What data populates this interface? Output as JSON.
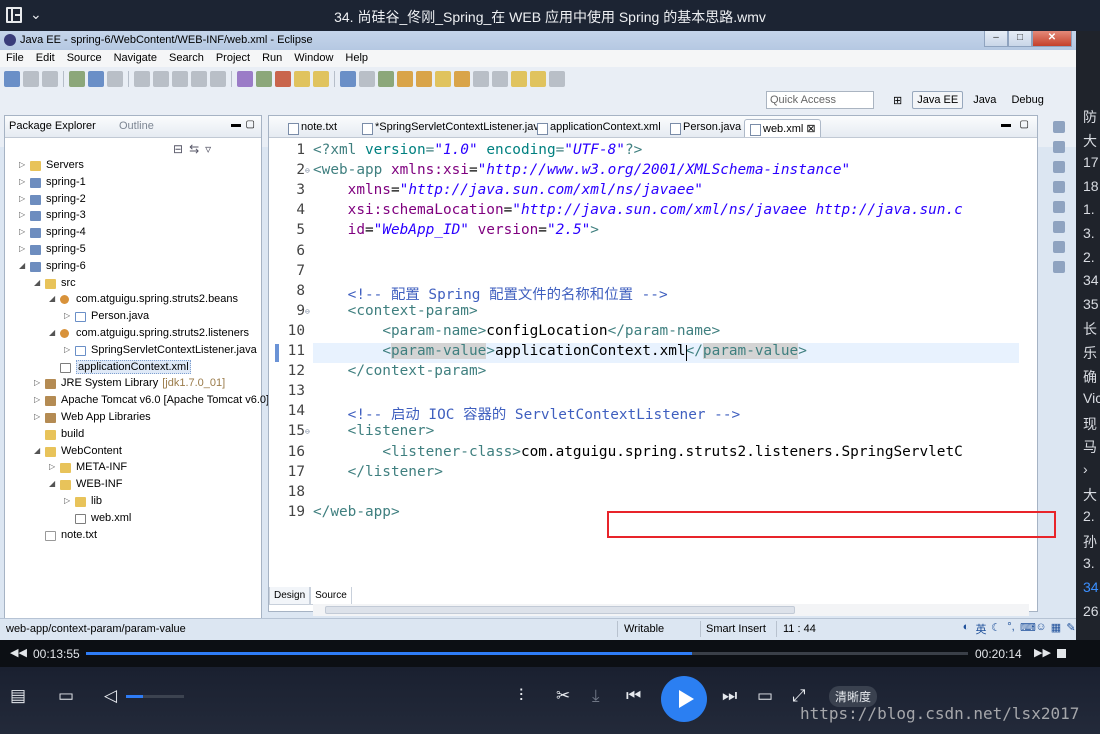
{
  "player": {
    "title": "34. 尚硅谷_佟刚_Spring_在 WEB 应用中使用 Spring 的基本思路.wmv",
    "time_current": "00:13:55",
    "time_total": "00:20:14",
    "progress_fraction": 0.687,
    "volume_fraction": 0.3,
    "quality_label": "清晰度",
    "watermark": "https://blog.csdn.net/lsx2017"
  },
  "eclipse": {
    "window_title": "Java EE - spring-6/WebContent/WEB-INF/web.xml - Eclipse",
    "menu": [
      "File",
      "Edit",
      "Source",
      "Navigate",
      "Search",
      "Project",
      "Run",
      "Window",
      "Help"
    ],
    "quick_access_placeholder": "Quick Access",
    "perspectives": [
      "Java EE",
      "Java",
      "Debug"
    ],
    "active_perspective": "Java EE"
  },
  "package_explorer": {
    "tab_label": "Package Explorer",
    "outline_label": "Outline",
    "tree": [
      {
        "depth": 0,
        "twisty": "▷",
        "icon": "folder",
        "label": "Servers"
      },
      {
        "depth": 0,
        "twisty": "▷",
        "icon": "proj",
        "label": "spring-1"
      },
      {
        "depth": 0,
        "twisty": "▷",
        "icon": "proj",
        "label": "spring-2"
      },
      {
        "depth": 0,
        "twisty": "▷",
        "icon": "proj",
        "label": "spring-3"
      },
      {
        "depth": 0,
        "twisty": "▷",
        "icon": "proj",
        "label": "spring-4"
      },
      {
        "depth": 0,
        "twisty": "▷",
        "icon": "proj",
        "label": "spring-5"
      },
      {
        "depth": 0,
        "twisty": "◢",
        "icon": "proj",
        "label": "spring-6"
      },
      {
        "depth": 1,
        "twisty": "◢",
        "icon": "folder",
        "label": "src"
      },
      {
        "depth": 2,
        "twisty": "◢",
        "icon": "pkg",
        "label": "com.atguigu.spring.struts2.beans"
      },
      {
        "depth": 3,
        "twisty": "▷",
        "icon": "java",
        "label": "Person.java"
      },
      {
        "depth": 2,
        "twisty": "◢",
        "icon": "pkg",
        "label": "com.atguigu.spring.struts2.listeners"
      },
      {
        "depth": 3,
        "twisty": "▷",
        "icon": "java",
        "label": "SpringServletContextListener.java"
      },
      {
        "depth": 2,
        "twisty": "",
        "icon": "xml",
        "label": "applicationContext.xml",
        "selected": true
      },
      {
        "depth": 1,
        "twisty": "▷",
        "icon": "lib",
        "label": "JRE System Library",
        "suffix": "[jdk1.7.0_01]"
      },
      {
        "depth": 1,
        "twisty": "▷",
        "icon": "lib",
        "label": "Apache Tomcat v6.0 [Apache Tomcat v6.0]"
      },
      {
        "depth": 1,
        "twisty": "▷",
        "icon": "lib",
        "label": "Web App Libraries"
      },
      {
        "depth": 1,
        "twisty": "",
        "icon": "folder",
        "label": "build"
      },
      {
        "depth": 1,
        "twisty": "◢",
        "icon": "folder",
        "label": "WebContent"
      },
      {
        "depth": 2,
        "twisty": "▷",
        "icon": "folder",
        "label": "META-INF"
      },
      {
        "depth": 2,
        "twisty": "◢",
        "icon": "folder",
        "label": "WEB-INF"
      },
      {
        "depth": 3,
        "twisty": "▷",
        "icon": "folder",
        "label": "lib"
      },
      {
        "depth": 3,
        "twisty": "",
        "icon": "xml",
        "label": "web.xml"
      },
      {
        "depth": 1,
        "twisty": "",
        "icon": "txt",
        "label": "note.txt"
      }
    ]
  },
  "editor": {
    "tabs": [
      {
        "label": "note.txt",
        "active": false
      },
      {
        "label": "*SpringServletContextListener.java",
        "active": false
      },
      {
        "label": "applicationContext.xml",
        "active": false
      },
      {
        "label": "Person.java",
        "active": false
      },
      {
        "label": "web.xml ⊠",
        "active": true
      }
    ],
    "lines": [
      {
        "n": "1",
        "fold": "",
        "parts": [
          [
            "tag",
            "<?xml "
          ],
          [
            "pi",
            "version"
          ],
          [
            "tag",
            "="
          ],
          [
            "val",
            "\"1.0\""
          ],
          [
            "tag",
            " "
          ],
          [
            "pi",
            "encoding"
          ],
          [
            "tag",
            "="
          ],
          [
            "val",
            "\"UTF-8\""
          ],
          [
            "tag",
            "?>"
          ]
        ]
      },
      {
        "n": "2",
        "fold": "⊖",
        "parts": [
          [
            "tag",
            "<web-app "
          ],
          [
            "attr",
            "xmlns:xsi"
          ],
          [
            "txt",
            "="
          ],
          [
            "val",
            "\"http://www.w3.org/2001/XMLSchema-instance\""
          ]
        ]
      },
      {
        "n": "3",
        "fold": "",
        "parts": [
          [
            "txt",
            "    "
          ],
          [
            "attr",
            "xmlns"
          ],
          [
            "txt",
            "="
          ],
          [
            "val",
            "\"http://java.sun.com/xml/ns/javaee\""
          ]
        ]
      },
      {
        "n": "4",
        "fold": "",
        "parts": [
          [
            "txt",
            "    "
          ],
          [
            "attr",
            "xsi:schemaLocation"
          ],
          [
            "txt",
            "="
          ],
          [
            "val",
            "\"http://java.sun.com/xml/ns/javaee http://java.sun.c"
          ]
        ]
      },
      {
        "n": "5",
        "fold": "",
        "parts": [
          [
            "txt",
            "    "
          ],
          [
            "attr",
            "id"
          ],
          [
            "txt",
            "="
          ],
          [
            "val",
            "\"WebApp_ID\""
          ],
          [
            "txt",
            " "
          ],
          [
            "attr",
            "version"
          ],
          [
            "txt",
            "="
          ],
          [
            "val",
            "\"2.5\""
          ],
          [
            "tag",
            ">"
          ]
        ]
      },
      {
        "n": "6",
        "fold": "",
        "parts": []
      },
      {
        "n": "7",
        "fold": "",
        "parts": []
      },
      {
        "n": "8",
        "fold": "",
        "parts": [
          [
            "txt",
            "    "
          ],
          [
            "cmt",
            "<!-- 配置 Spring 配置文件的名称和位置 -->"
          ]
        ]
      },
      {
        "n": "9",
        "fold": "⊖",
        "parts": [
          [
            "txt",
            "    "
          ],
          [
            "tag",
            "<context-param>"
          ]
        ]
      },
      {
        "n": "10",
        "fold": "",
        "parts": [
          [
            "txt",
            "        "
          ],
          [
            "tag",
            "<param-name>"
          ],
          [
            "txt",
            "configLocation"
          ],
          [
            "tag",
            "</param-name>"
          ]
        ]
      },
      {
        "n": "11",
        "fold": "",
        "parts": [
          [
            "txt",
            "        "
          ],
          [
            "tag",
            "<"
          ],
          [
            "taghl",
            "param-value"
          ],
          [
            "tag",
            ">"
          ],
          [
            "txt",
            "applicationContext.xml"
          ],
          [
            "tag",
            "</"
          ],
          [
            "taghl",
            "param-value"
          ],
          [
            "tag",
            ">"
          ]
        ]
      },
      {
        "n": "12",
        "fold": "",
        "parts": [
          [
            "txt",
            "    "
          ],
          [
            "tag",
            "</context-param>"
          ]
        ]
      },
      {
        "n": "13",
        "fold": "",
        "parts": []
      },
      {
        "n": "14",
        "fold": "",
        "parts": [
          [
            "txt",
            "    "
          ],
          [
            "cmt",
            "<!-- 启动 IOC 容器的 ServletContextListener -->"
          ]
        ]
      },
      {
        "n": "15",
        "fold": "⊖",
        "parts": [
          [
            "txt",
            "    "
          ],
          [
            "tag",
            "<listener>"
          ]
        ]
      },
      {
        "n": "16",
        "fold": "",
        "parts": [
          [
            "txt",
            "        "
          ],
          [
            "tag",
            "<listener-class>"
          ],
          [
            "txt",
            "com.atguigu.spring.struts2.listeners.SpringServletC"
          ]
        ]
      },
      {
        "n": "17",
        "fold": "",
        "parts": [
          [
            "txt",
            "    "
          ],
          [
            "tag",
            "</listener>"
          ]
        ]
      },
      {
        "n": "18",
        "fold": "",
        "parts": []
      },
      {
        "n": "19",
        "fold": "",
        "parts": [
          [
            "tag",
            "</web-app>"
          ]
        ]
      }
    ],
    "bottom_tabs": [
      "Design",
      "Source"
    ],
    "active_bottom_tab": "Source"
  },
  "status_bar": {
    "path": "web-app/context-param/param-value",
    "writable": "Writable",
    "insert_mode": "Smart Insert",
    "position": "11 : 44",
    "ime_lang": "英"
  },
  "side_panel": {
    "items": [
      "防",
      "大",
      "17",
      "18",
      "1.",
      "3.",
      "2.",
      "34",
      "35",
      "长",
      "乐",
      "确",
      "Vic",
      "现",
      "马",
      "›",
      "大",
      "2.",
      "孙",
      "3.",
      "34",
      "26."
    ],
    "highlighted_index": 20
  }
}
